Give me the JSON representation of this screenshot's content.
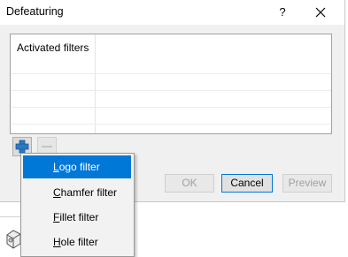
{
  "dialog": {
    "title": "Defeaturing",
    "help_glyph": "?",
    "table": {
      "column_header": "Activated filters"
    },
    "buttons": {
      "ok": "OK",
      "cancel": "Cancel",
      "preview": "Preview"
    }
  },
  "context_menu": {
    "items": [
      {
        "label": "Logo filter",
        "underline": "L"
      },
      {
        "label": "Chamfer filter",
        "underline": "C"
      },
      {
        "label": "Fillet filter",
        "underline": "F"
      },
      {
        "label": "Hole filter",
        "underline": "H"
      }
    ],
    "highlighted_index": 0
  },
  "colors": {
    "accent": "#0078d7",
    "dialog_bg": "#f0f0f0"
  }
}
